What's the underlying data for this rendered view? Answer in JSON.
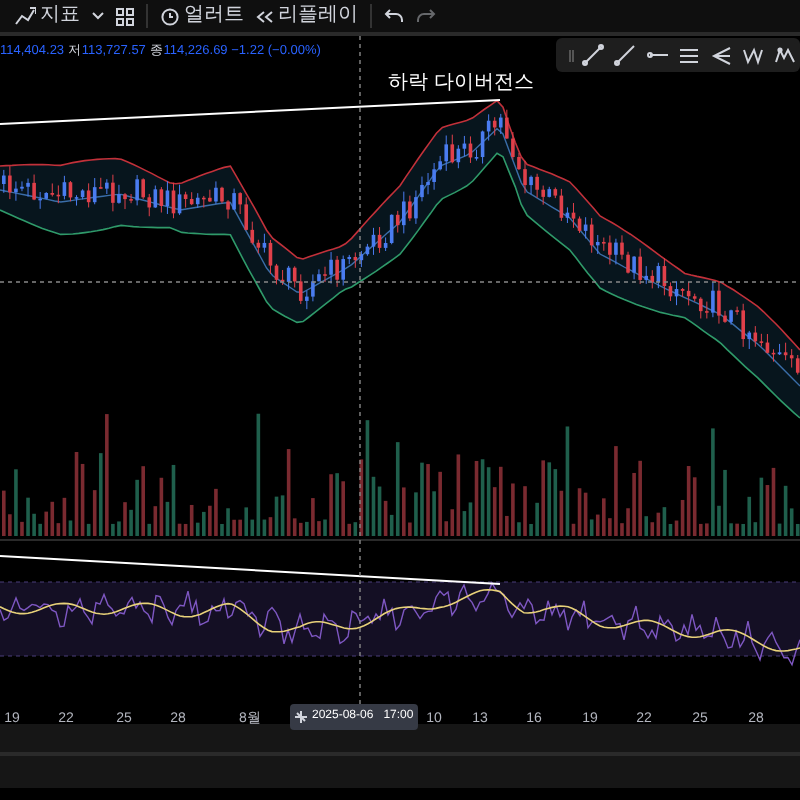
{
  "toolbar": {
    "items": [
      {
        "kind": "icon-text",
        "label": "지표"
      },
      {
        "kind": "caret"
      },
      {
        "kind": "templates"
      },
      {
        "kind": "separator"
      },
      {
        "kind": "alert",
        "label": "얼러트"
      },
      {
        "kind": "replay",
        "label": "리플레이"
      },
      {
        "kind": "separator"
      },
      {
        "kind": "undo"
      },
      {
        "kind": "redo"
      }
    ]
  },
  "legend": {
    "segments": [
      {
        "value": "114,404.23"
      },
      {
        "prefix": "저",
        "value": "113,727.57"
      },
      {
        "prefix": "종",
        "value": "114,226.69"
      },
      {
        "value": "−1.22 (−0.00%)"
      }
    ]
  },
  "annotation": {
    "text": "하락 다이버전스"
  },
  "x_axis": {
    "labels": [
      "19",
      "22",
      "25",
      "28",
      "8월",
      "10",
      "13",
      "16",
      "19",
      "22",
      "25",
      "28"
    ]
  },
  "crosshair": {
    "date": "2025-08-06",
    "time": "17:00"
  }
}
